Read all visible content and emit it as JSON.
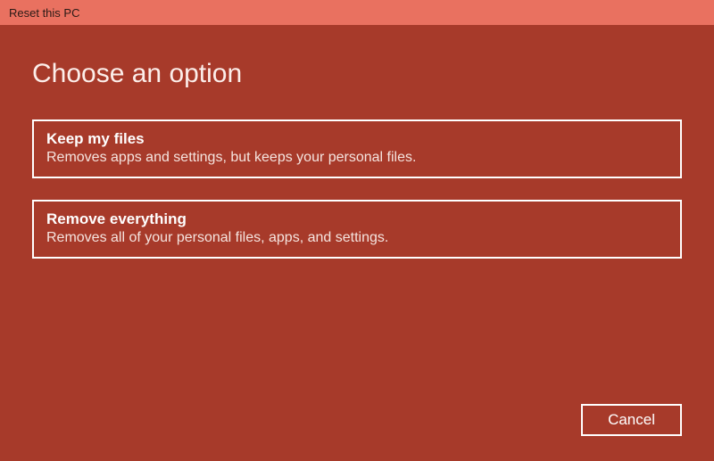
{
  "titlebar": {
    "title": "Reset this PC"
  },
  "heading": "Choose an option",
  "options": [
    {
      "title": "Keep my files",
      "description": "Removes apps and settings, but keeps your personal files."
    },
    {
      "title": "Remove everything",
      "description": "Removes all of your personal files, apps, and settings."
    }
  ],
  "footer": {
    "cancel_label": "Cancel"
  }
}
